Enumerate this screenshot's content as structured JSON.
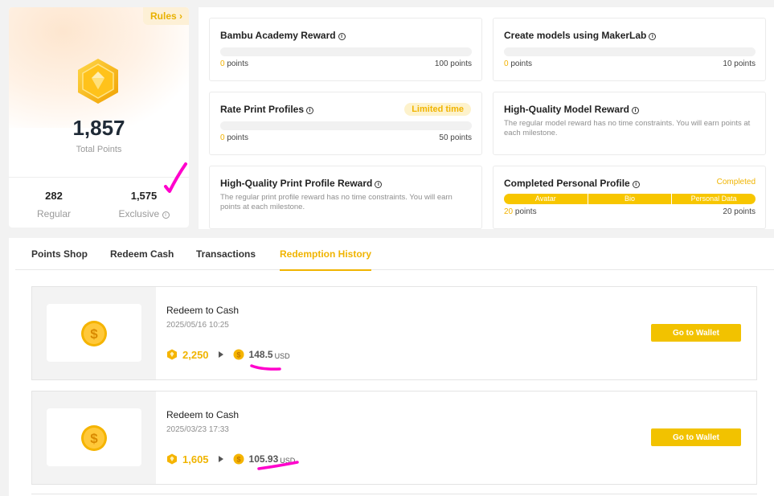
{
  "summary": {
    "rules_label": "Rules ›",
    "total_points": "1,857",
    "total_label": "Total Points",
    "regular_value": "282",
    "regular_label": "Regular",
    "exclusive_value": "1,575",
    "exclusive_label": "Exclusive"
  },
  "tasks": {
    "academy": {
      "title": "Bambu Academy Reward",
      "progress": "0",
      "progress_unit": " points",
      "target": "100 points"
    },
    "makerlab": {
      "title": "Create models using MakerLab",
      "progress": "0",
      "progress_unit": " points",
      "target": "10 points"
    },
    "rate": {
      "title": "Rate Print Profiles",
      "tag": "Limited time",
      "progress": "0",
      "progress_unit": " points",
      "target": "50 points"
    },
    "hq_model": {
      "title": "High-Quality Model Reward",
      "desc": "The regular model reward has no time constraints. You will earn points at each milestone."
    },
    "hq_profile": {
      "title": "High-Quality Print Profile Reward",
      "desc": "The regular print profile reward has no time constraints. You will earn points at each milestone."
    },
    "profile": {
      "title": "Completed Personal Profile",
      "status": "Completed",
      "segments": [
        "Avatar",
        "Bio",
        "Personal Data"
      ],
      "progress": "20",
      "progress_unit": " points",
      "target": "20 points"
    }
  },
  "tabs": [
    "Points Shop",
    "Redeem Cash",
    "Transactions",
    "Redemption History"
  ],
  "active_tab": "Redemption History",
  "records": [
    {
      "title": "Redeem to Cash",
      "date": "2025/05/16 10:25",
      "points": "2,250",
      "amount": "148.5",
      "currency": "USD",
      "button": "Go to Wallet"
    },
    {
      "title": "Redeem to Cash",
      "date": "2025/03/23 17:33",
      "points": "1,605",
      "amount": "105.93",
      "currency": "USD",
      "button": "Go to Wallet"
    }
  ],
  "icons": {
    "medal": "diamond-medal-icon",
    "coin": "dollar-coin-icon",
    "points": "points-coin-icon",
    "info": "info-icon"
  },
  "colors": {
    "accent": "#f0b400",
    "button": "#f2c200",
    "annotation": "#ff00cc"
  }
}
